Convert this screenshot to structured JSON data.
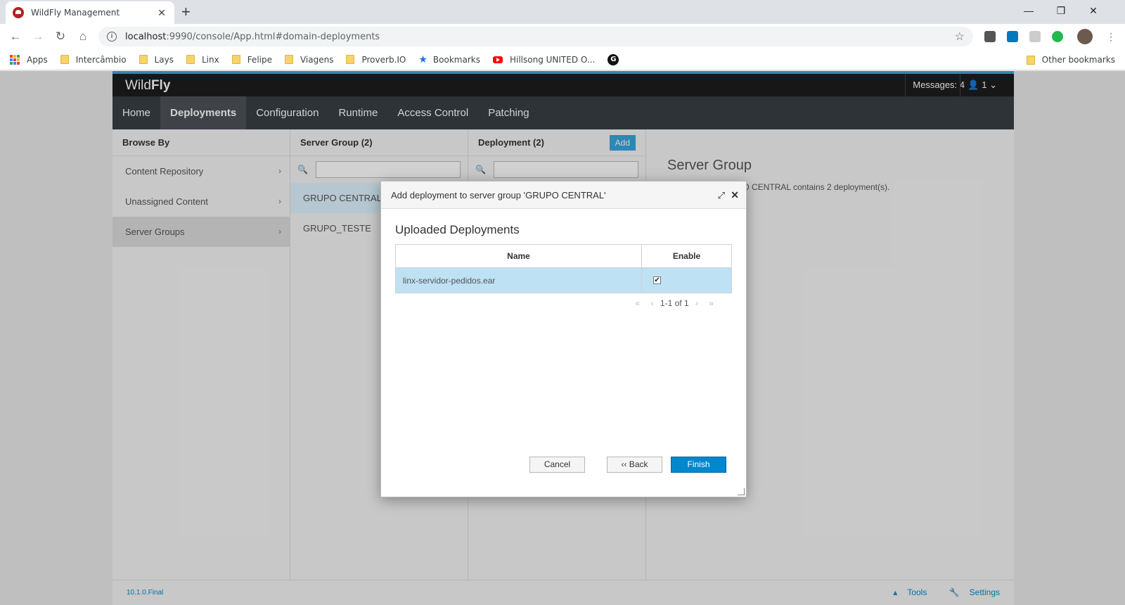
{
  "browser": {
    "tab_title": "WildFly Management",
    "tab_close": "✕",
    "new_tab": "+",
    "window_controls": [
      "—",
      "❐",
      "✕"
    ],
    "url_host": "localhost",
    "url_path": ":9990/console/App.html#domain-deployments",
    "bookmarks": [
      "Apps",
      "Intercâmbio",
      "Lays",
      "Linx",
      "Felipe",
      "Viagens",
      "Proverb.IO",
      "Bookmarks",
      "Hillsong UNITED O..."
    ],
    "bookmark_g": "G",
    "other_bookmarks": "Other bookmarks"
  },
  "app": {
    "brand_light": "Wild",
    "brand_bold": "Fly",
    "messages": "Messages: 4",
    "user": "1",
    "nav": [
      "Home",
      "Deployments",
      "Configuration",
      "Runtime",
      "Access Control",
      "Patching"
    ],
    "browse_by": {
      "title": "Browse By",
      "items": [
        "Content Repository",
        "Unassigned Content",
        "Server Groups"
      ]
    },
    "server_group_col": {
      "title": "Server Group (2)",
      "items": [
        "GRUPO CENTRAL",
        "GRUPO_TESTE"
      ]
    },
    "deployment_col": {
      "title": "Deployment (2)",
      "add_label": "Add"
    },
    "details": {
      "title": "Server Group",
      "text": "Server group GRUPO CENTRAL contains 2 deployment(s)."
    },
    "footer": {
      "version": "10.1.0.Final",
      "tools": "Tools",
      "settings": "Settings"
    }
  },
  "modal": {
    "title": "Add deployment to server group 'GRUPO CENTRAL'",
    "section_title": "Uploaded Deployments",
    "columns": [
      "Name",
      "Enable"
    ],
    "rows": [
      {
        "name": "linx-servidor-pedidos.ear",
        "enabled": true
      }
    ],
    "pager": "1-1 of 1",
    "cancel_label": "Cancel",
    "back_label": "‹‹ Back",
    "finish_label": "Finish"
  },
  "colors": {
    "accent": "#39a5dc",
    "primary_button": "#0088ce",
    "selected_row": "#bee1f4",
    "nav_bg": "#393f44",
    "header_bg": "#1d1d1d"
  }
}
